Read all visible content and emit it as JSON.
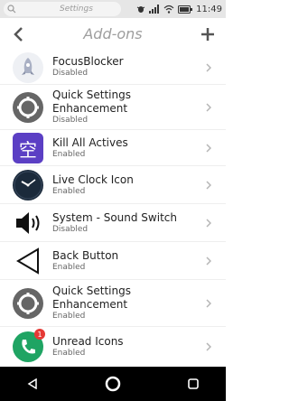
{
  "status_bar": {
    "search_text": "Settings",
    "time": "11:49"
  },
  "header": {
    "title": "Add-ons"
  },
  "addons": [
    {
      "name_line1": "FocusBlocker",
      "name_line2": "",
      "status": "Disabled",
      "icon": "rocket-icon"
    },
    {
      "name_line1": "Quick Settings",
      "name_line2": "Enhancement",
      "status": "Disabled",
      "icon": "gear-icon"
    },
    {
      "name_line1": "Kill All Actives",
      "name_line2": "",
      "status": "Enabled",
      "icon": "kanji-kong-icon",
      "icon_text": "空"
    },
    {
      "name_line1": "Live Clock Icon",
      "name_line2": "",
      "status": "Enabled",
      "icon": "clock-icon"
    },
    {
      "name_line1": "System - Sound Switch",
      "name_line2": "",
      "status": "Disabled",
      "icon": "speaker-icon"
    },
    {
      "name_line1": "Back Button",
      "name_line2": "",
      "status": "Enabled",
      "icon": "back-triangle-icon"
    },
    {
      "name_line1": "Quick Settings",
      "name_line2": "Enhancement",
      "status": "Enabled",
      "icon": "gear-icon"
    },
    {
      "name_line1": "Unread Icons",
      "name_line2": "",
      "status": "Enabled",
      "icon": "phone-icon",
      "badge": "1"
    }
  ],
  "colors": {
    "accent_purple": "#5b3fc4",
    "gear_gray": "#666666",
    "phone_green": "#1fa463",
    "badge_red": "#e53935"
  }
}
